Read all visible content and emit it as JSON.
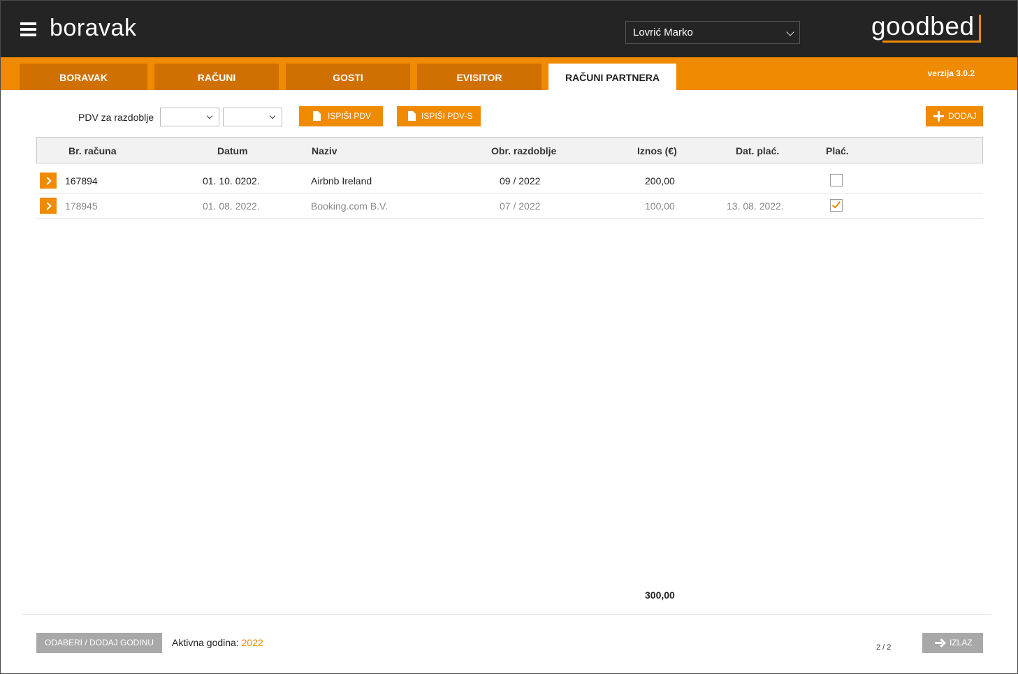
{
  "header": {
    "app_title": "boravak",
    "user_selected": "Lovrić Marko",
    "logo_text": "goodbed"
  },
  "tabs": [
    {
      "label": "BORAVAK",
      "active": false
    },
    {
      "label": "RAČUNI",
      "active": false
    },
    {
      "label": "GOSTI",
      "active": false
    },
    {
      "label": "EVISITOR",
      "active": false
    },
    {
      "label": "RAČUNI PARTNERA",
      "active": true
    }
  ],
  "version": "verzija 3.0.2",
  "toolbar": {
    "pdv_label": "PDV za razdoblje",
    "period_month": "",
    "period_year": "",
    "ispisi_pdv": "ISPIŠI PDV",
    "ispisi_pdvs": "ISPIŠI PDV-S",
    "dodaj": "DODAJ"
  },
  "table": {
    "columns": [
      "Br. računa",
      "Datum",
      "Naziv",
      "Obr. razdoblje",
      "Iznos (€)",
      "Dat. plać.",
      "Plać."
    ],
    "rows": [
      {
        "broj": "167894",
        "datum": "01. 10. 0202.",
        "naziv": "Airbnb Ireland",
        "razdoblje": "09 / 2022",
        "iznos": "200,00",
        "dat_placanja": "",
        "placeno": false
      },
      {
        "broj": "178945",
        "datum": "01. 08. 2022.",
        "naziv": "Booking.com B.V.",
        "razdoblje": "07 / 2022",
        "iznos": "100,00",
        "dat_placanja": "13. 08. 2022.",
        "placeno": true
      }
    ],
    "total": "300,00"
  },
  "footer": {
    "godina_button": "ODABERI / DODAJ GODINU",
    "aktivna_label": "Aktivna godina:",
    "aktivna_value": "2022",
    "page_indicator": "2 / 2",
    "izlaz": "IZLAZ"
  },
  "colors": {
    "accent": "#f08a00",
    "tab_inactive": "#cf7000",
    "header_bg": "#242424"
  }
}
